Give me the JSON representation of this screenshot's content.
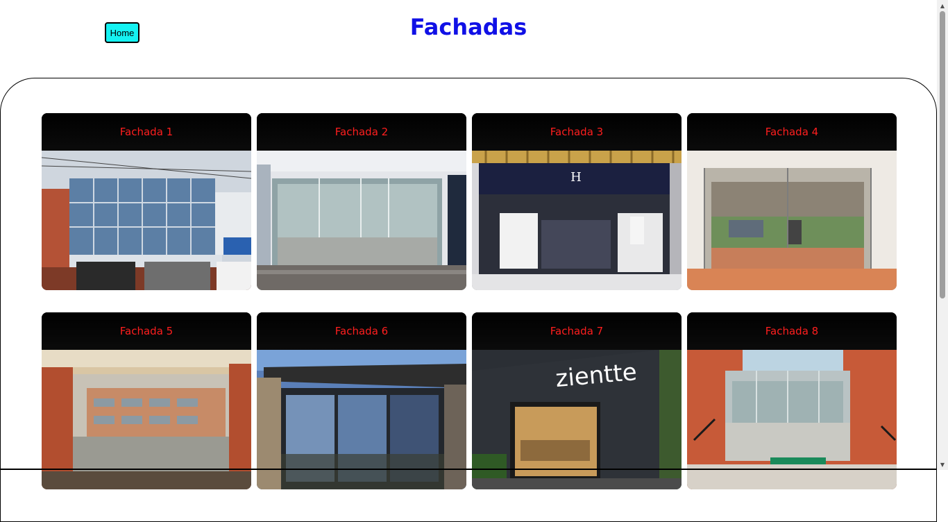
{
  "header": {
    "home_label": "Home",
    "title": "Fachadas"
  },
  "colors": {
    "home_button_bg": "#15f2f2",
    "title": "#1010e6",
    "card_title": "#ff1e1e",
    "card_bg": "#000000"
  },
  "gallery": {
    "cards": [
      {
        "title": "Fachada 1",
        "image": "office-building-glass-facade"
      },
      {
        "title": "Fachada 2",
        "image": "empty-glass-storefront"
      },
      {
        "title": "Fachada 3",
        "image": "hans-sachs-store-front"
      },
      {
        "title": "Fachada 4",
        "image": "glass-door-entrance"
      },
      {
        "title": "Fachada 5",
        "image": "lobby-glass-entrance"
      },
      {
        "title": "Fachada 6",
        "image": "dark-glass-corner-storefront"
      },
      {
        "title": "Fachada 7",
        "image": "zientte-store-front",
        "sign_text": "zientte"
      },
      {
        "title": "Fachada 8",
        "image": "brick-building-glass-entrance"
      }
    ]
  }
}
